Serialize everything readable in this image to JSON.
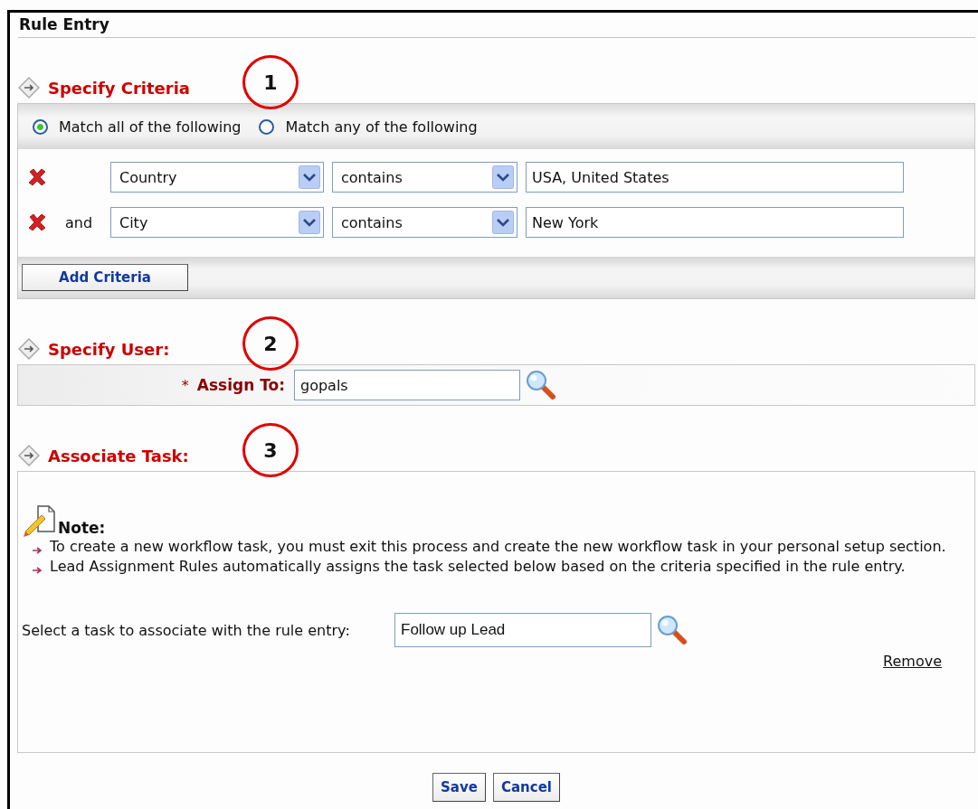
{
  "title": "Rule Entry",
  "criteria": {
    "heading": "Specify Criteria",
    "callout": "1",
    "match_options": [
      {
        "label": "Match all of the following",
        "selected": true
      },
      {
        "label": "Match any of the following",
        "selected": false
      }
    ],
    "rules": [
      {
        "field": "Country",
        "operator": "contains",
        "value": "USA, United States"
      },
      {
        "conjunction": "and",
        "field": "City",
        "operator": "contains",
        "value": "New York"
      }
    ],
    "add_button": "Add Criteria"
  },
  "user": {
    "heading": "Specify User:",
    "callout": "2",
    "required_mark": "*",
    "label": "Assign To:",
    "value": "gopals"
  },
  "task": {
    "heading": "Associate Task:",
    "callout": "3",
    "note_title": "Note:",
    "notes": [
      "To create a new workflow task, you must exit this process and create the new workflow task in your personal setup section.",
      "Lead Assignment Rules automatically assigns the task selected below based on the criteria specified in the rule entry."
    ],
    "select_label": "Select a task to associate with the rule entry:",
    "value": "Follow up Lead",
    "remove_link": "Remove"
  },
  "buttons": [
    "Save",
    "Cancel"
  ]
}
